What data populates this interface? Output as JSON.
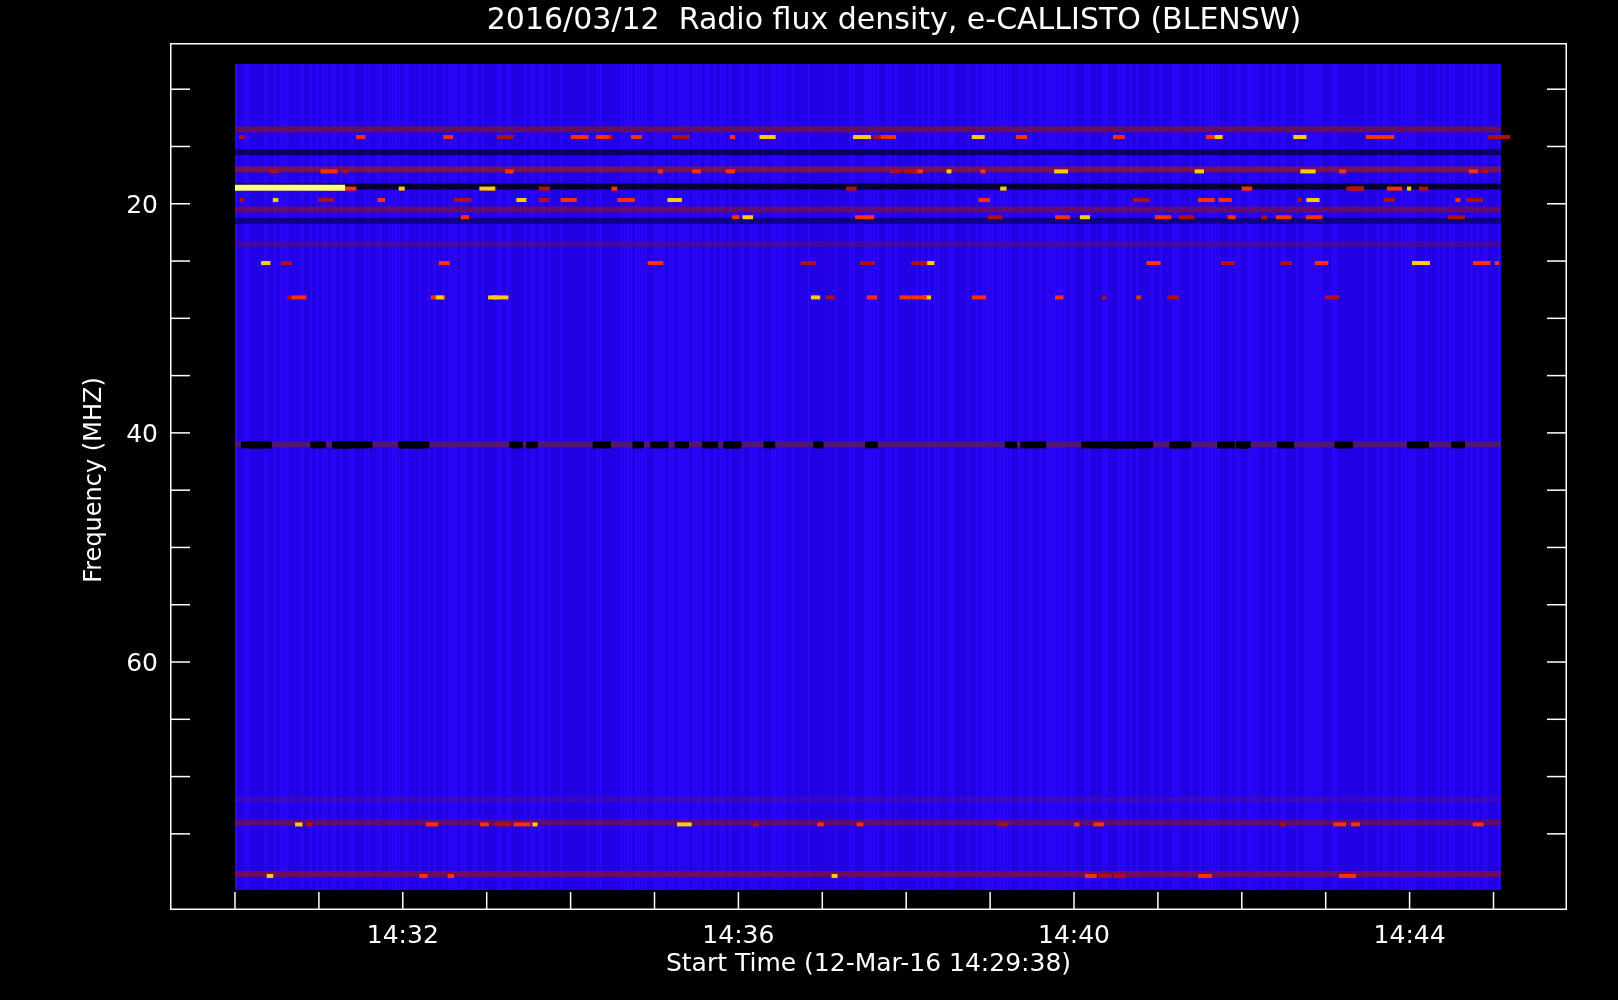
{
  "title": "2016/03/12  Radio flux density, e-CALLISTO (BLENSW)",
  "y_axis": {
    "label": "Frequency (MHZ)",
    "ticks": [
      "20",
      "40",
      "60"
    ]
  },
  "x_axis": {
    "label": "Start Time (12-Mar-16 14:29:38)",
    "ticks": [
      "14:32",
      "14:36",
      "14:40",
      "14:44"
    ]
  }
}
